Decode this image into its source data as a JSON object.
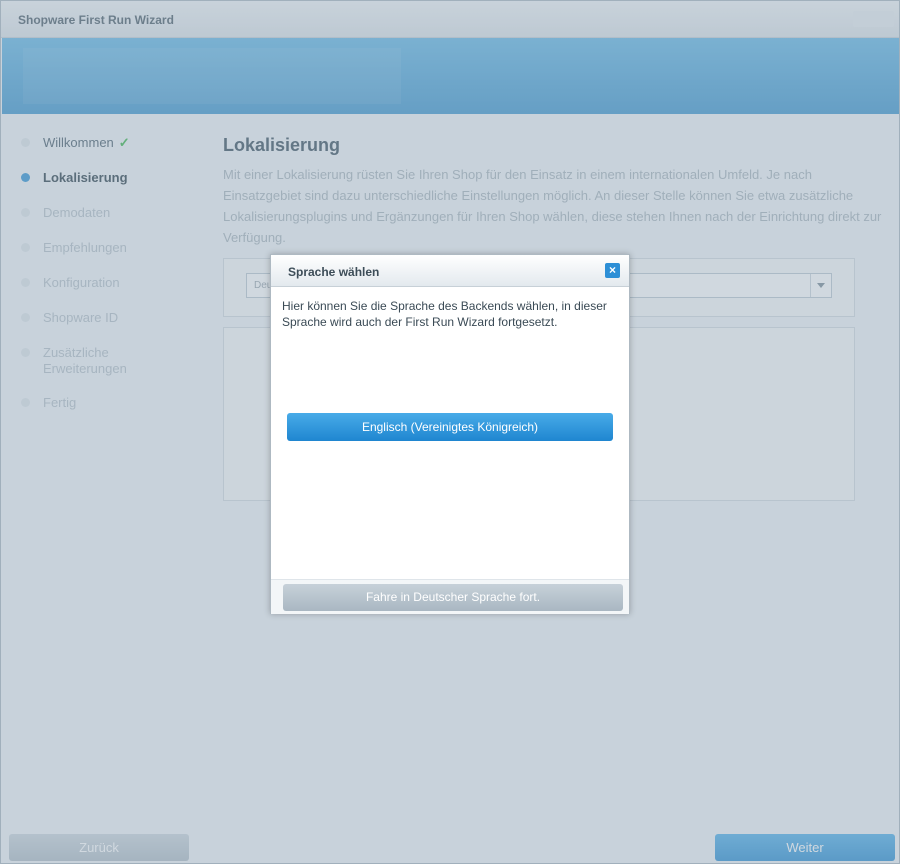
{
  "window": {
    "title": "Shopware First Run Wizard"
  },
  "nav": {
    "items": [
      {
        "label": "Willkommen",
        "check": "✓"
      },
      {
        "label": "Lokalisierung"
      },
      {
        "label": "Demodaten"
      },
      {
        "label": "Empfehlungen"
      },
      {
        "label": "Konfiguration"
      },
      {
        "label": "Shopware ID"
      },
      {
        "label": "Zusätzliche Erweiterungen"
      },
      {
        "label": "Fertig"
      }
    ]
  },
  "main": {
    "heading": "Lokalisierung",
    "description": "Mit einer Lokalisierung rüsten Sie Ihren Shop für den Einsatz in einem internationalen Umfeld. Je nach Einsatzgebiet sind dazu unterschiedliche Einstellungen möglich. An dieser Stelle können Sie etwa zusätzliche Lokalisierungsplugins und Ergänzungen für Ihren Shop wählen, diese stehen Ihnen nach der Einrichtung direkt zur Verfügung.",
    "locale_select_value": "Deu"
  },
  "footer": {
    "back_label": "Zurück",
    "next_label": "Weiter"
  },
  "dialog": {
    "title": "Sprache wählen",
    "close_glyph": "×",
    "text": "Hier können Sie die Sprache des Backends wählen, in dieser Sprache wird auch der First Run Wizard fortgesetzt.",
    "english_button": "Englisch (Vereinigtes Königreich)",
    "german_button": "Fahre in Deutscher Sprache fort."
  },
  "colors": {
    "accent": "#2b8fd4",
    "banner": "#4fa8dc",
    "success": "#39b54a"
  }
}
